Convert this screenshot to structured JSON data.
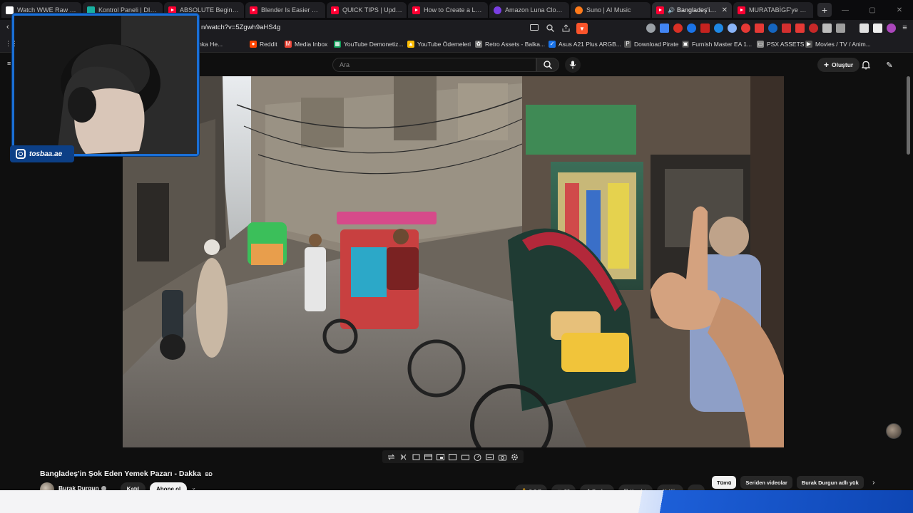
{
  "browser": {
    "tabs": [
      {
        "label": "Watch WWE Raw Sma",
        "favicon": "doc",
        "active": false
      },
      {
        "label": "Kontrol Paneli | DISBO",
        "favicon": "panel",
        "active": false
      },
      {
        "label": "ABSOLUTE Beginner B",
        "favicon": "youtube",
        "active": false
      },
      {
        "label": "Blender Is Easier Than",
        "favicon": "youtube",
        "active": false
      },
      {
        "label": "QUICK TIPS | Update",
        "favicon": "youtube",
        "active": false
      },
      {
        "label": "How to Create a Low P",
        "favicon": "youtube",
        "active": false
      },
      {
        "label": "Amazon Luna Cloud G",
        "favicon": "amazon-luna",
        "active": false
      },
      {
        "label": "Suno | AI Music",
        "favicon": "suno",
        "active": false
      },
      {
        "label": "Bangladeş'in Şo",
        "favicon": "youtube",
        "active": true,
        "audio": true
      },
      {
        "label": "MURATABİGF'ye Eşek",
        "favicon": "youtube",
        "active": false
      }
    ],
    "url": "n/watch?v=5Zgwh9aHS4g",
    "bookmarks": [
      {
        "label": "neer: Banka He...",
        "icon": "none"
      },
      {
        "label": "Reddit",
        "icon": "reddit"
      },
      {
        "label": "Media Inbox",
        "icon": "gmail"
      },
      {
        "label": "YouTube Demonetiz...",
        "icon": "sheets"
      },
      {
        "label": "YouTube Ödemeleri",
        "icon": "drive"
      },
      {
        "label": "Retro Assets - Balka...",
        "icon": "gear"
      },
      {
        "label": "Asus A21 Plus ARGB...",
        "icon": "check"
      },
      {
        "label": "Download Pirate",
        "icon": "p"
      },
      {
        "label": "Furnish Master EA 1...",
        "icon": "box"
      },
      {
        "label": "PSX ASSETS",
        "icon": "folder"
      },
      {
        "label": "Movies / TV / Anim...",
        "icon": "play"
      }
    ]
  },
  "youtube": {
    "search_placeholder": "Ara",
    "create_label": "Oluştur",
    "video_title": "Bangladeş'in Şok Eden Yemek Pazarı - Dakka",
    "title_flag": "BD",
    "channel_name": "Burak Durgun",
    "join_label": "Katıl",
    "subscribe_label": "Abone ol",
    "actions": [
      {
        "label": "9,8 B",
        "icon": "like-icon"
      },
      {
        "label": "99",
        "icon": "comment-icon"
      },
      {
        "label": "Paylaş",
        "icon": "share-icon"
      },
      {
        "label": "Kaydet",
        "icon": "save-icon"
      },
      {
        "label": "Klip",
        "icon": "clip-icon"
      }
    ],
    "chips": [
      {
        "label": "Tümü",
        "selected": true
      },
      {
        "label": "Seriden videolar",
        "selected": false
      },
      {
        "label": "Burak Durgun adlı yük",
        "selected": false
      }
    ]
  },
  "overlay": {
    "instagram_handle": "tosbaa.ae"
  },
  "colors": {
    "youtube_red": "#ff0033",
    "webcam_border": "#1a6fd6",
    "badge_blue": "#0c3f86",
    "page_bg": "#0f0f0f"
  }
}
